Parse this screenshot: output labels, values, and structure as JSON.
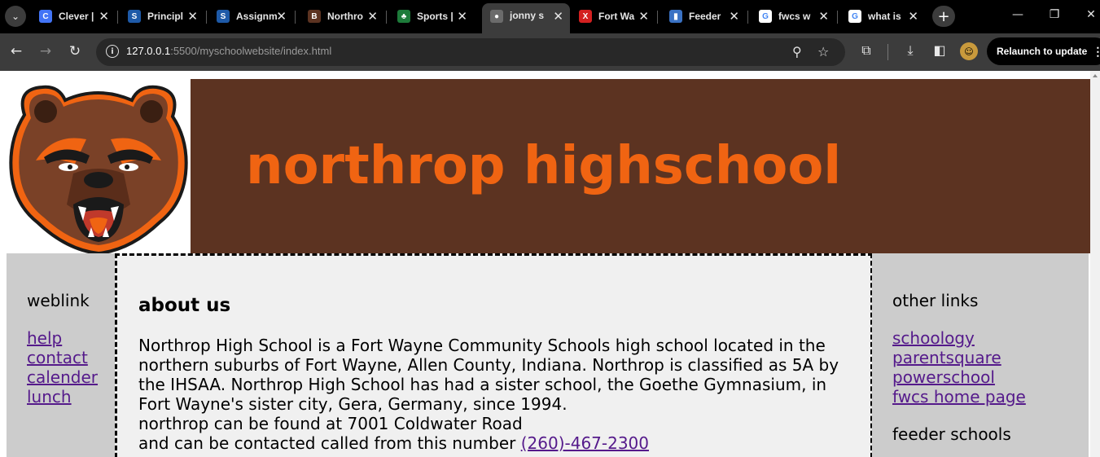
{
  "browser": {
    "tabs": [
      {
        "label": "Clever |",
        "favicon": "clever-icon",
        "fav_color": "#4274f6",
        "fav_glyph": "C"
      },
      {
        "label": "Principl",
        "favicon": "schoology-icon",
        "fav_color": "#1e5aa8",
        "fav_glyph": "S"
      },
      {
        "label": "Assignm",
        "favicon": "schoology-icon",
        "fav_color": "#1e5aa8",
        "fav_glyph": "S"
      },
      {
        "label": "Northro",
        "favicon": "bear-icon",
        "fav_color": "#5c3321",
        "fav_glyph": "B"
      },
      {
        "label": "Sports |",
        "favicon": "sports-icon",
        "fav_color": "#1d7b3a",
        "fav_glyph": "♣"
      },
      {
        "label": "jonny s",
        "favicon": "globe-icon",
        "fav_color": "#6b6b6b",
        "fav_glyph": "●",
        "active": true
      },
      {
        "label": "Fort Wa",
        "favicon": "fort-wayne-icon",
        "fav_color": "#d32020",
        "fav_glyph": "X"
      },
      {
        "label": "Feeder",
        "favicon": "feeder-icon",
        "fav_color": "#3a72c4",
        "fav_glyph": "▮"
      },
      {
        "label": "fwcs w",
        "favicon": "google-icon",
        "fav_color": "#ffffff",
        "fav_glyph": "G"
      },
      {
        "label": "what is",
        "favicon": "google-icon",
        "fav_color": "#ffffff",
        "fav_glyph": "G"
      }
    ],
    "url": {
      "host": "127.0.0.1",
      "rest": ":5500/myschoolwebsite/index.html"
    },
    "relaunch_label": "Relaunch to update"
  },
  "site": {
    "title": "northrop highschool",
    "banner_bg": "#5c3321",
    "title_color": "#f06412",
    "left_nav": {
      "heading": "weblink",
      "links": [
        "help",
        "contact",
        "calender",
        "lunch"
      ]
    },
    "about": {
      "heading": "about us",
      "paragraph": "Northrop High School is a Fort Wayne Community Schools high school located in the northern suburbs of Fort Wayne, Allen County, Indiana. Northrop is classified as 5A by the IHSAA. Northrop High School has had a sister school, the Goethe Gymnasium, in Fort Wayne's sister city, Gera, Germany, since 1994.",
      "address_line": "northrop can be found at 7001 Coldwater Road",
      "contact_line": "and can be contacted called from this number",
      "phone": "(260)-467-2300"
    },
    "right_nav": {
      "heading": "other links",
      "links": [
        "schoology",
        "parentsquare",
        "powerschool",
        "fwcs home page"
      ],
      "heading2": "feeder schools"
    }
  }
}
